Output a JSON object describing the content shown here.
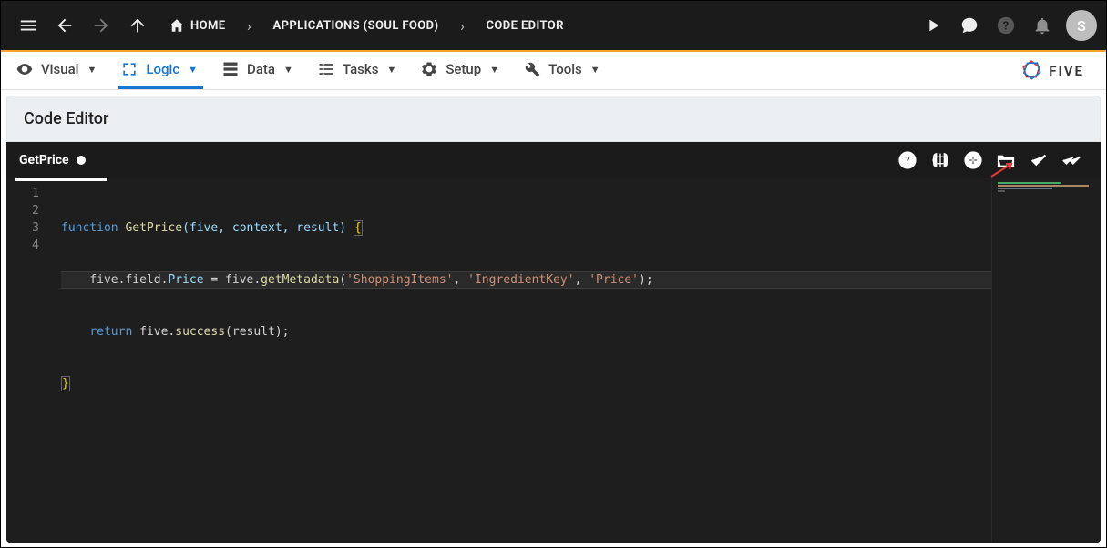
{
  "topbar": {
    "home_label": "HOME",
    "crumb2": "APPLICATIONS (SOUL FOOD)",
    "crumb3": "CODE EDITOR",
    "avatar_letter": "S"
  },
  "nav": {
    "tabs": [
      {
        "label": "Visual"
      },
      {
        "label": "Logic"
      },
      {
        "label": "Data"
      },
      {
        "label": "Tasks"
      },
      {
        "label": "Setup"
      },
      {
        "label": "Tools"
      }
    ],
    "brand": "FIVE"
  },
  "page": {
    "title": "Code Editor"
  },
  "editor": {
    "filename": "GetPrice",
    "lines": [
      "1",
      "2",
      "3",
      "4"
    ],
    "code": {
      "l1": {
        "kw": "function",
        "fn": "GetPrice",
        "params": "(five, context, result)",
        "open": "{"
      },
      "l2": {
        "indent": "    ",
        "a": "five.field.",
        "prop": "Price",
        "b": " = five.",
        "fn": "getMetadata",
        "c": "(",
        "s1": "'ShoppingItems'",
        "d": ", ",
        "s2": "'IngredientKey'",
        "e": ", ",
        "s3": "'Price'",
        "f": ");"
      },
      "l3": {
        "indent": "    ",
        "kw": "return",
        "a": " five.",
        "fn": "success",
        "b": "(result);"
      },
      "l4": {
        "close": "}"
      }
    }
  }
}
